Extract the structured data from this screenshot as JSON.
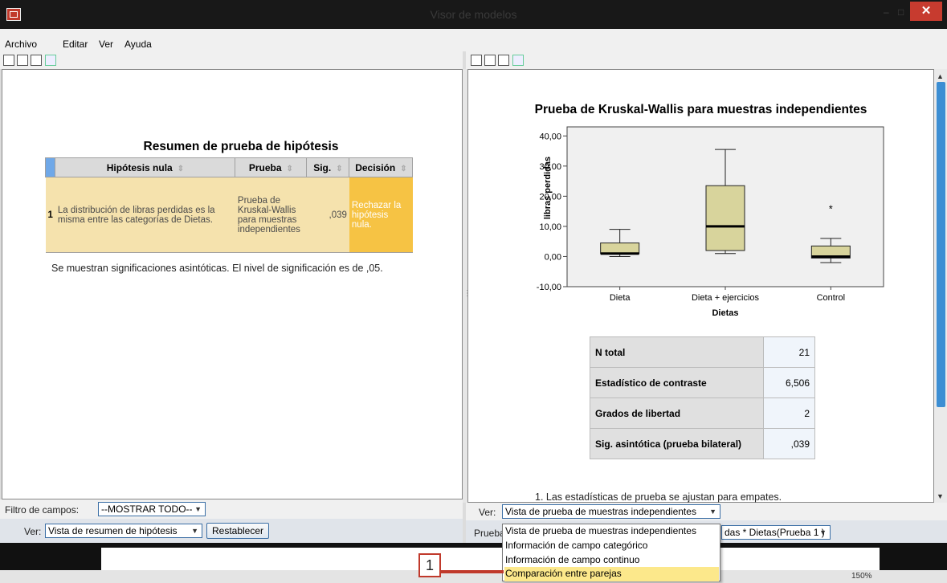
{
  "window": {
    "title": "Visor de modelos",
    "minimize": "–",
    "maximize": "□",
    "close": "✕"
  },
  "menu": {
    "items": [
      "Archivo",
      "Editar",
      "Ver",
      "Ayuda"
    ]
  },
  "left": {
    "title": "Resumen de prueba de hipótesis",
    "columns": [
      "Hipótesis nula",
      "Prueba",
      "Sig.",
      "Decisión"
    ],
    "rows": [
      {
        "num": "1",
        "hypothesis": "La distribución de libras perdidas es la misma entre las categorías de Dietas.",
        "test": "Prueba de Kruskal-Wallis para muestras independientes",
        "sig": ",039",
        "decision": "Rechazar la hipótesis nula."
      }
    ],
    "note": "Se muestran significaciones asintóticas.  El nivel de significación es de ,05.",
    "filter_label": "Filtro de campos:",
    "filter_value": "--MOSTRAR TODO--",
    "view_label": "Ver:",
    "view_value": "Vista de resumen de hipótesis",
    "reset_button": "Restablecer"
  },
  "right": {
    "view_label": "Ver:",
    "view_value": "Vista de prueba de muestras independientes",
    "test_label": "Prueba",
    "test_value": "das * Dietas(Prueba 1 )",
    "stats": [
      {
        "label": "N total",
        "value": "21"
      },
      {
        "label": "Estadístico de contraste",
        "value": "6,506"
      },
      {
        "label": "Grados de libertad",
        "value": "2"
      },
      {
        "label": "Sig. asintótica (prueba bilateral)",
        "value": ",039"
      }
    ],
    "footnote": "1.  Las estadísticas de prueba se ajustan para empates.",
    "dropdown": [
      "Vista de prueba de muestras independientes",
      "Información de campo categórico",
      "Información de campo continuo",
      "Comparación entre parejas"
    ]
  },
  "callout": {
    "number": "1"
  },
  "status": {
    "zoom": "150%"
  },
  "chart_data": {
    "type": "boxplot",
    "title": "Prueba de Kruskal-Wallis para muestras independientes",
    "xlabel": "Dietas",
    "ylabel": "libras perdidas",
    "ylim": [
      -10,
      43
    ],
    "yticks": [
      "40,00",
      "30,00",
      "20,00",
      "10,00",
      "0,00",
      "-10,00"
    ],
    "box_color": "#d8d49c",
    "categories": [
      "Dieta",
      "Dieta + ejercicios",
      "Control"
    ],
    "boxes": [
      {
        "min": 0,
        "q1": 1,
        "median": 1,
        "q3": 4.5,
        "max": 9
      },
      {
        "min": 1,
        "q1": 2,
        "median": 10,
        "q3": 23.5,
        "max": 35.5
      },
      {
        "min": -2,
        "q1": -0.5,
        "median": 0,
        "q3": 3.5,
        "max": 6,
        "outliers": [
          16
        ]
      }
    ]
  }
}
